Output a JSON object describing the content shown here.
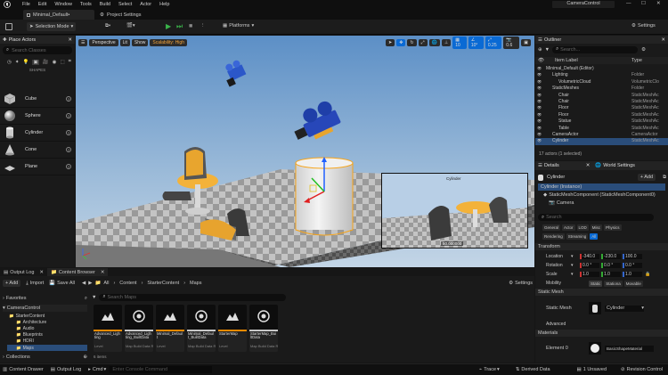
{
  "menu": {
    "items": [
      "File",
      "Edit",
      "Window",
      "Tools",
      "Build",
      "Select",
      "Actor",
      "Help"
    ],
    "project": "CameraControl"
  },
  "tabs": {
    "level": "Minimal_Default•",
    "settings": "Project Settings"
  },
  "toolbar": {
    "selection_mode": "Selection Mode",
    "platforms": "Platforms",
    "settings": "Settings"
  },
  "place_actors": {
    "title": "Place Actors",
    "search_placeholder": "Search Classes",
    "section": "SHAPES",
    "shapes": [
      "Cube",
      "Sphere",
      "Cylinder",
      "Cone",
      "Plane"
    ]
  },
  "viewport": {
    "perspective": "Perspective",
    "lit": "Lit",
    "show": "Show",
    "scalability": "Scalability: High",
    "grid_size": "10",
    "rot_snap": "10°",
    "scale_snap": "0.25",
    "cam_speed": "0.6",
    "preview_label": "Cylinder",
    "preview_value": "50.000000"
  },
  "outliner": {
    "title": "Outliner",
    "search_placeholder": "Search...",
    "col_item": "Item Label",
    "col_type": "Type",
    "rows": [
      {
        "name": "Minimal_Default (Editor)",
        "type": "",
        "indent": 0,
        "sel": false
      },
      {
        "name": "Lighting",
        "type": "Folder",
        "indent": 1,
        "sel": false
      },
      {
        "name": "VolumetricCloud",
        "type": "VolumetricClo",
        "indent": 2,
        "sel": false
      },
      {
        "name": "StaticMeshes",
        "type": "Folder",
        "indent": 1,
        "sel": false
      },
      {
        "name": "Chair",
        "type": "StaticMeshAc",
        "indent": 2,
        "sel": false
      },
      {
        "name": "Chair",
        "type": "StaticMeshAc",
        "indent": 2,
        "sel": false
      },
      {
        "name": "Floor",
        "type": "StaticMeshAc",
        "indent": 2,
        "sel": false
      },
      {
        "name": "Floor",
        "type": "StaticMeshAc",
        "indent": 2,
        "sel": false
      },
      {
        "name": "Statue",
        "type": "StaticMeshAc",
        "indent": 2,
        "sel": false
      },
      {
        "name": "Table",
        "type": "StaticMeshAc",
        "indent": 2,
        "sel": false
      },
      {
        "name": "CameraActor",
        "type": "CameraActor",
        "indent": 1,
        "sel": false
      },
      {
        "name": "Cylinder",
        "type": "StaticMeshAc",
        "indent": 1,
        "sel": true
      }
    ],
    "footer": "17 actors (1 selected)"
  },
  "details": {
    "tab1": "Details",
    "tab2": "World Settings",
    "object": "Cylinder",
    "add": "+ Add",
    "instance": "Cylinder (Instance)",
    "component": "StaticMeshComponent (StaticMeshComponent0)",
    "camera": "Camera",
    "search_placeholder": "Search",
    "cats1": [
      "General",
      "Actor",
      "LOD",
      "Misc",
      "Physics"
    ],
    "cats2": [
      "Rendering",
      "Streaming",
      "All"
    ],
    "transform": "Transform",
    "location": "Location",
    "rotation": "Rotation",
    "scale": "Scale",
    "loc": [
      "-340.0",
      "-230.0",
      "100.0"
    ],
    "rot": [
      "0.0 °",
      "0.0 °",
      "0.0 °"
    ],
    "scl": [
      "1.0",
      "1.0",
      "1.0"
    ],
    "mobility": "Mobility",
    "mob_opts": [
      "Static",
      "Stationa",
      "Movable"
    ],
    "static_mesh_section": "Static Mesh",
    "static_mesh_label": "Static Mesh",
    "static_mesh_value": "Cylinder",
    "advanced": "Advanced",
    "materials": "Materials",
    "element0": "Element 0",
    "material_value": "BasicShapeMaterial"
  },
  "content_browser": {
    "tab_log": "Output Log",
    "tab_cb": "Content Browser",
    "add": "+ Add",
    "import": "Import",
    "save_all": "Save All",
    "crumbs": [
      "All",
      "Content",
      "StarterContent",
      "Maps"
    ],
    "settings": "Settings",
    "favorites": "Favorites",
    "project": "CameraControl",
    "search_placeholder": "Search Maps",
    "items_count": "6 items",
    "collections": "Collections",
    "tree": [
      "StarterContent",
      "Architecture",
      "Audio",
      "Blueprints",
      "HDRI",
      "Maps"
    ],
    "assets": [
      {
        "name": "Advanced_Lighting",
        "type": "Level"
      },
      {
        "name": "Advanced_Lighting_BuiltData",
        "type": "Map Build Data Registry"
      },
      {
        "name": "Minimal_Default",
        "type": "Level"
      },
      {
        "name": "Minimal_Default_BuiltData",
        "type": "Map Build Data Registry"
      },
      {
        "name": "StarterMap",
        "type": "Level"
      },
      {
        "name": "StarterMap_BuiltData",
        "type": "Map Build Data Registry"
      }
    ]
  },
  "statusbar": {
    "drawer": "Content Drawer",
    "output": "Output Log",
    "cmd": "Cmd",
    "console_placeholder": "Enter Console Command",
    "trace": "Trace",
    "derived": "Derived Data",
    "unsaved": "1 Unsaved",
    "revision": "Revision Control"
  },
  "colors": {
    "accent": "#0070e0",
    "play": "#3ab34a",
    "selected": "#2a4d7a"
  }
}
